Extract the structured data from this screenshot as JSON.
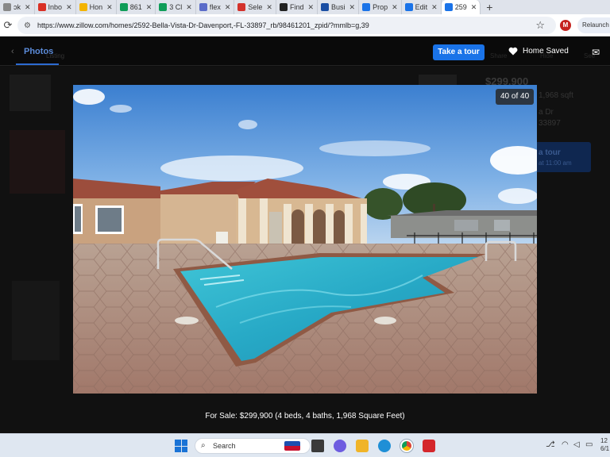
{
  "browser": {
    "tabs": [
      {
        "label": "ɔk",
        "icon": "generic-page-icon",
        "color": "#888888"
      },
      {
        "label": "Inbo",
        "icon": "gmail-icon",
        "color": "#d93025"
      },
      {
        "label": "Hon",
        "icon": "google-drive-icon",
        "color": "#f4b400"
      },
      {
        "label": "861",
        "icon": "google-sheets-icon",
        "color": "#0f9d58"
      },
      {
        "label": "3 Cl",
        "icon": "google-sheets-icon",
        "color": "#0f9d58"
      },
      {
        "label": "flex",
        "icon": "generic-page-icon",
        "color": "#5b6cc9"
      },
      {
        "label": "Sele",
        "icon": "generic-page-icon",
        "color": "#d3322c"
      },
      {
        "label": "Find",
        "icon": "generic-page-icon",
        "color": "#222222"
      },
      {
        "label": "Busi",
        "icon": "generic-page-icon",
        "color": "#1a4ea3"
      },
      {
        "label": "Prop",
        "icon": "zillow-icon",
        "color": "#1a73e8"
      },
      {
        "label": "Edit",
        "icon": "zillow-icon",
        "color": "#1a73e8"
      },
      {
        "label": "259",
        "icon": "zillow-icon",
        "color": "#1a73e8",
        "active": true
      }
    ],
    "url": "https://www.zillow.com/homes/2592-Bella-Vista-Dr-Davenport,-FL-33897_rb/98461201_zpid/?mmlb=g,39",
    "profile_initial": "M",
    "relaunch_label": "Relaunch t"
  },
  "header": {
    "photos_tab": "Photos",
    "back_label": "Listing",
    "take_tour": "Take a tour",
    "home_saved": "Home Saved"
  },
  "background": {
    "price": "$299,900",
    "sqft": "1,968 sqft",
    "addr1": "a Dr",
    "addr2": "33897",
    "tour_ghost": "a tour",
    "tour_ghost_sub": "at 11:00 am",
    "share_ghost": "Share",
    "hide_ghost": "Hide",
    "see_ghost": "See"
  },
  "viewer": {
    "counter": "40 of 40",
    "caption": "For Sale: $299,900 (4 beds, 4 baths, 1,968 Square Feet)"
  },
  "taskbar": {
    "search_placeholder": "Search",
    "time": "12",
    "date": "6/1"
  }
}
